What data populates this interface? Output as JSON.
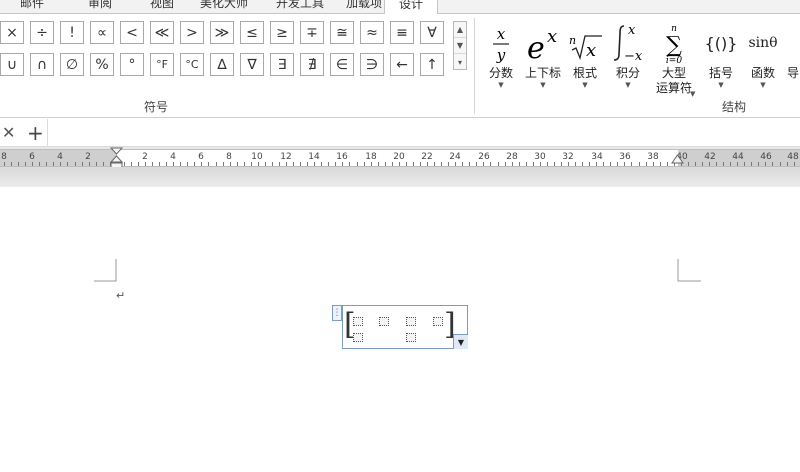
{
  "tabs": [
    {
      "label": "邮件"
    },
    {
      "label": "审阅"
    },
    {
      "label": "视图"
    },
    {
      "label": "美化大师"
    },
    {
      "label": "开发工具"
    },
    {
      "label": "加载项"
    },
    {
      "label": "设计"
    }
  ],
  "symbols": {
    "group_label": "符号",
    "row1": [
      "×",
      "÷",
      "!",
      "∝",
      "<",
      "≪",
      ">",
      "≫",
      "≤",
      "≥",
      "∓",
      "≅",
      "≈",
      "≡",
      "∀"
    ],
    "row2": [
      "∪",
      "∩",
      "∅",
      "%",
      "°",
      "°F",
      "°C",
      "∆",
      "∇",
      "∃",
      "∄",
      "∈",
      "∋",
      "←",
      "↑"
    ],
    "scroll_up": "▲",
    "scroll_down": "▼",
    "more": "▾"
  },
  "structures": {
    "group_label": "结构",
    "items": [
      {
        "label": "分数",
        "icon": "fraction-icon"
      },
      {
        "label": "上下标",
        "icon": "script-icon"
      },
      {
        "label": "根式",
        "icon": "radical-icon"
      },
      {
        "label": "积分",
        "icon": "integral-icon"
      },
      {
        "label": "大型\n运算符",
        "icon": "large-operator-icon"
      },
      {
        "label": "括号",
        "icon": "bracket-icon"
      },
      {
        "label": "函数",
        "icon": "function-icon"
      },
      {
        "label": "导",
        "icon": "accent-icon"
      }
    ],
    "fraction_num": "x",
    "fraction_den": "y",
    "script_base": "e",
    "script_sup": "x",
    "radical_index": "n",
    "radical_body": "x",
    "integral_upper": "x",
    "integral_lower": "−x",
    "sum_upper": "n",
    "sum_lower": "i=0",
    "bracket_text": "{()}",
    "function_text": "sinθ"
  },
  "docbar": {
    "close": "✕",
    "add": "+"
  },
  "ruler": {
    "labels": [
      "8",
      "6",
      "4",
      "2",
      "",
      "2",
      "4",
      "6",
      "8",
      "10",
      "12",
      "14",
      "16",
      "18",
      "20",
      "22",
      "24",
      "26",
      "28",
      "30",
      "32",
      "34",
      "36",
      "38",
      "40",
      "42",
      "44",
      "46",
      "48"
    ]
  },
  "document": {
    "paragraph_mark": "↵"
  },
  "equation": {
    "left_bracket": "[",
    "right_bracket": "]",
    "handle": "⋮",
    "dropdown": "▼"
  },
  "colors": {
    "equation_border": "#7a9cc6",
    "ribbon_border": "#c6c6c6"
  }
}
